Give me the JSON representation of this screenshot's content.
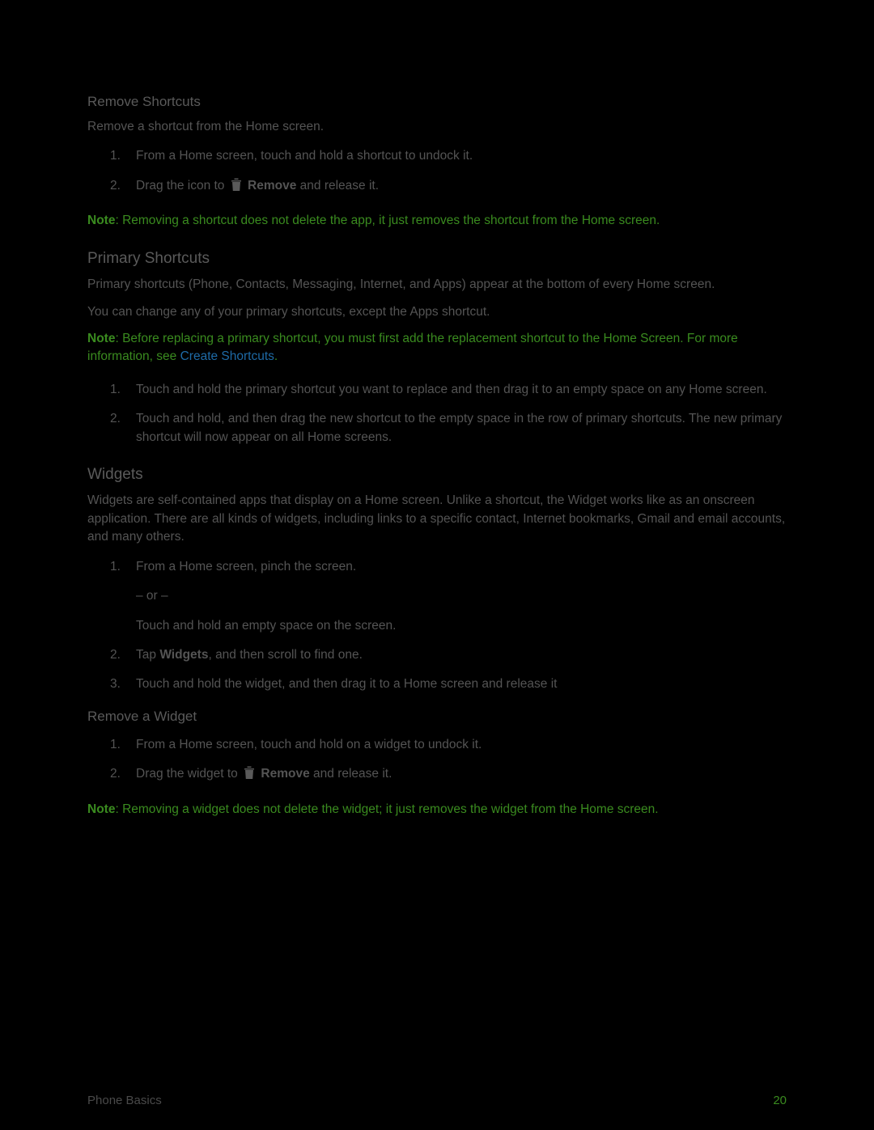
{
  "sections": {
    "removeShortcuts": {
      "title": "Remove Shortcuts",
      "intro": "Remove a shortcut from the Home screen.",
      "steps": [
        "From a Home screen, touch and hold a shortcut to undock it.",
        "Drag the icon to ",
        " and release it."
      ],
      "removeWord": "Remove",
      "noteLabel": "Note",
      "noteBody": ": Removing a shortcut does not delete the app, it just removes the shortcut from the Home screen."
    },
    "primaryShortcuts": {
      "title": "Primary Shortcuts",
      "intro1": "Primary shortcuts (Phone, Contacts, Messaging, Internet, and Apps) appear at the bottom of every Home screen.",
      "intro2": "You can change any of your primary shortcuts, except the Apps shortcut.",
      "noteLabel": "Note",
      "noteBody": ": Before replacing a primary shortcut, you must first add the replacement shortcut to the Home Screen. For more information, see ",
      "noteLink": "Create Shortcuts",
      "noteTail": ".",
      "steps": [
        "Touch and hold the primary shortcut you want to replace and then drag it to an empty space on any Home screen.",
        "Touch and hold, and then drag the new shortcut to the empty space in the row of primary shortcuts. The new primary shortcut will now appear on all Home screens."
      ]
    },
    "widgets": {
      "title": "Widgets",
      "intro": "Widgets are self-contained apps that display on a Home screen. Unlike a shortcut, the Widget works like as an onscreen application. There are all kinds of widgets, including links to a specific contact, Internet bookmarks, Gmail and email accounts, and many others.",
      "step1a": "From a Home screen, pinch the screen.",
      "orText": "– or –",
      "step1b": "Touch and hold an empty space on the screen.",
      "step2a": "Tap ",
      "step2bold": "Widgets",
      "step2b": ", and then scroll to find one.",
      "step3": "Touch and hold the widget, and then drag it to a Home screen and release it"
    },
    "removeWidget": {
      "title": "Remove a Widget",
      "steps": [
        "From a Home screen, touch and hold on a widget to undock it.",
        "Drag the widget to ",
        " and release it."
      ],
      "removeWord": "Remove",
      "noteLabel": "Note",
      "noteBody": ": Removing a widget does not delete the widget; it just removes the widget from the Home screen."
    }
  },
  "footer": {
    "left": "Phone Basics",
    "page": "20"
  }
}
